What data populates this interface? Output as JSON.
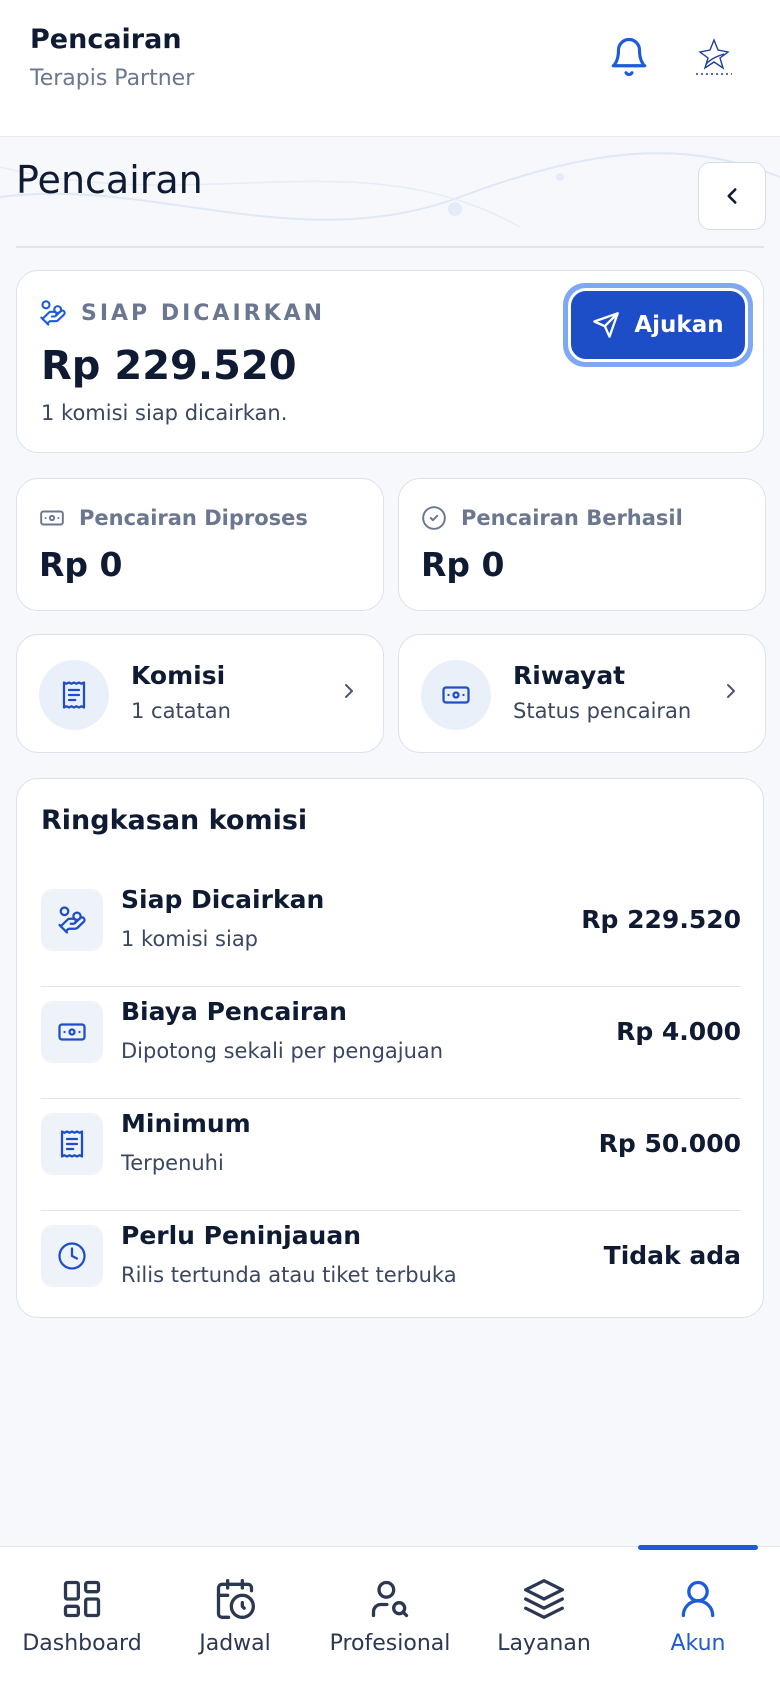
{
  "header": {
    "title": "Pencairan",
    "subtitle": "Terapis Partner"
  },
  "page": {
    "title": "Pencairan"
  },
  "hero": {
    "label": "SIAP DICAIRKAN",
    "amount": "Rp 229.520",
    "note": "1 komisi siap dicairkan.",
    "button_label": "Ajukan"
  },
  "stats": [
    {
      "label": "Pencairan Diproses",
      "value": "Rp 0",
      "icon": "money-icon"
    },
    {
      "label": "Pencairan Berhasil",
      "value": "Rp 0",
      "icon": "check-circle-icon"
    }
  ],
  "nav_cards": [
    {
      "title": "Komisi",
      "subtitle": "1 catatan",
      "icon": "receipt-icon"
    },
    {
      "title": "Riwayat",
      "subtitle": "Status pencairan",
      "icon": "money-icon"
    }
  ],
  "summary": {
    "title": "Ringkasan komisi",
    "rows": [
      {
        "title": "Siap Dicairkan",
        "subtitle": "1 komisi siap",
        "value": "Rp 229.520",
        "icon": "hand-coins-icon"
      },
      {
        "title": "Biaya Pencairan",
        "subtitle": "Dipotong sekali per pengajuan",
        "value": "Rp 4.000",
        "icon": "money-icon"
      },
      {
        "title": "Minimum",
        "subtitle": "Terpenuhi",
        "value": "Rp 50.000",
        "icon": "receipt-icon"
      },
      {
        "title": "Perlu Peninjauan",
        "subtitle": "Rilis tertunda atau tiket terbuka",
        "value": "Tidak ada",
        "icon": "clock-icon"
      }
    ]
  },
  "bottom_nav": [
    {
      "label": "Dashboard",
      "icon": "grid-icon",
      "active": false
    },
    {
      "label": "Jadwal",
      "icon": "calendar-clock-icon",
      "active": false
    },
    {
      "label": "Profesional",
      "icon": "user-search-icon",
      "active": false
    },
    {
      "label": "Layanan",
      "icon": "layers-icon",
      "active": false
    },
    {
      "label": "Akun",
      "icon": "user-icon",
      "active": true
    }
  ],
  "colors": {
    "primary": "#1d4ec7",
    "accent": "#1d5bd8",
    "muted": "#6b7790",
    "text": "#0f1a33"
  }
}
